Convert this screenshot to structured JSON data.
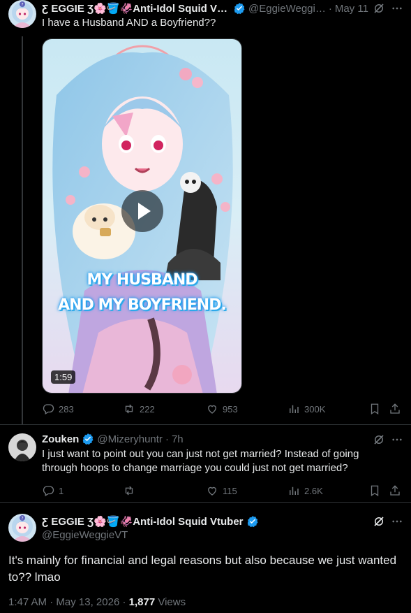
{
  "original": {
    "name": "Ƹ EGGIE Ʒ🌸🪣🦑Anti-Idol Squid Vt…",
    "handle": "@EggieWeggi…",
    "separator": "·",
    "date": "May 11",
    "text": "I have a Husband AND a Boyfriend??",
    "media": {
      "overlay_line1": "MY HUSBAND",
      "overlay_line2": "AND MY BOYFRIEND.",
      "duration": "1:59"
    },
    "actions": {
      "replies": "283",
      "reposts": "222",
      "likes": "953",
      "views": "300K"
    }
  },
  "reply": {
    "name": "Zouken",
    "handle": "@Mizeryhuntr",
    "separator": "·",
    "date": "7h",
    "text_line1": "I just want to point out you can just not get married? Instead of going",
    "text_line2": "through hoops to change marriage you could just not get married?",
    "actions": {
      "replies": "1",
      "reposts": "",
      "likes": "115",
      "views": "2.6K"
    }
  },
  "main": {
    "name": "Ƹ EGGIE Ʒ🌸🪣🦑Anti-Idol Squid Vtuber",
    "handle": "@EggieWeggieVT",
    "text": "It's mainly for financial and legal reasons but also because we just wanted to?? lmao",
    "time": "1:47 AM",
    "date_sep": "·",
    "date": "May 13, 2026",
    "views_sep": "·",
    "views_count": "1,877",
    "views_label": "Views"
  },
  "colors": {
    "background": "#000000",
    "text": "#e7e9ea",
    "muted": "#71767b",
    "verified": "#1d9bf0",
    "divider": "#2f3336"
  }
}
